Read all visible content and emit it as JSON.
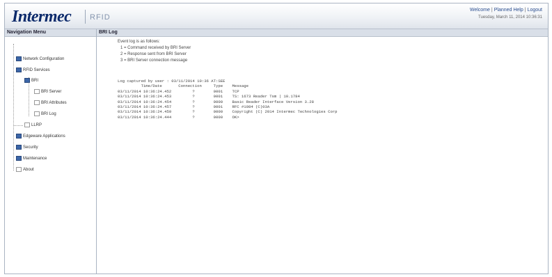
{
  "header": {
    "brand": "Intermec",
    "product": "RFID",
    "links": [
      "Welcome",
      "Planned Help",
      "Logout"
    ],
    "datetime": "Tuesday, March 11, 2014 10:36:31"
  },
  "sidebar": {
    "title": "Navigation Menu",
    "items": [
      {
        "label": "Network Configuration",
        "icon": "blue-book-icon"
      },
      {
        "label": "RFID Services",
        "icon": "blue-book-icon"
      },
      {
        "label": "BRI",
        "icon": "blue-book-icon"
      },
      {
        "label": "BRI Server",
        "icon": "page-icon"
      },
      {
        "label": "BRI Attributes",
        "icon": "page-icon"
      },
      {
        "label": "BRI Log",
        "icon": "page-icon"
      },
      {
        "label": "LLRP",
        "icon": "page-icon"
      },
      {
        "label": "Edgeware Applications",
        "icon": "blue-book-icon"
      },
      {
        "label": "Security",
        "icon": "blue-book-icon"
      },
      {
        "label": "Maintenance",
        "icon": "blue-book-icon"
      },
      {
        "label": "About",
        "icon": "page-icon"
      }
    ]
  },
  "main": {
    "title": "BRI Log",
    "legend_title": "Event log is as follows:",
    "legend": [
      "1 = Command received by BRI Server",
      "2 = Response sent from BRI Server",
      "3 = BRI Server connection message"
    ],
    "log_header": "Log captured by user : 03/11/2014 10:36 AT:SEE",
    "columns": [
      "Time/Date",
      "Connection",
      "Type",
      "Message"
    ],
    "rows": [
      [
        "03/11/2014 10:36:24.452",
        "?",
        "0001",
        "TCP"
      ],
      [
        "03/11/2014 10:36:24.453",
        "?",
        "0001",
        "TS: 1673 Reader Tsm | 10.1784"
      ],
      [
        "03/11/2014 10:36:24.454",
        "?",
        "0000",
        "Basic Reader Interface Version 3.28"
      ],
      [
        "03/11/2014 10:36:24.457",
        "?",
        "0001",
        "RFC #1084 (C)03A"
      ],
      [
        "03/11/2014 10:36:24.459",
        "?",
        "0000",
        "Copyright (C) 2014 Intermec Technologies Corp"
      ],
      [
        "03/11/2014 10:36:24.444",
        "?",
        "0000",
        "OK>"
      ]
    ]
  }
}
